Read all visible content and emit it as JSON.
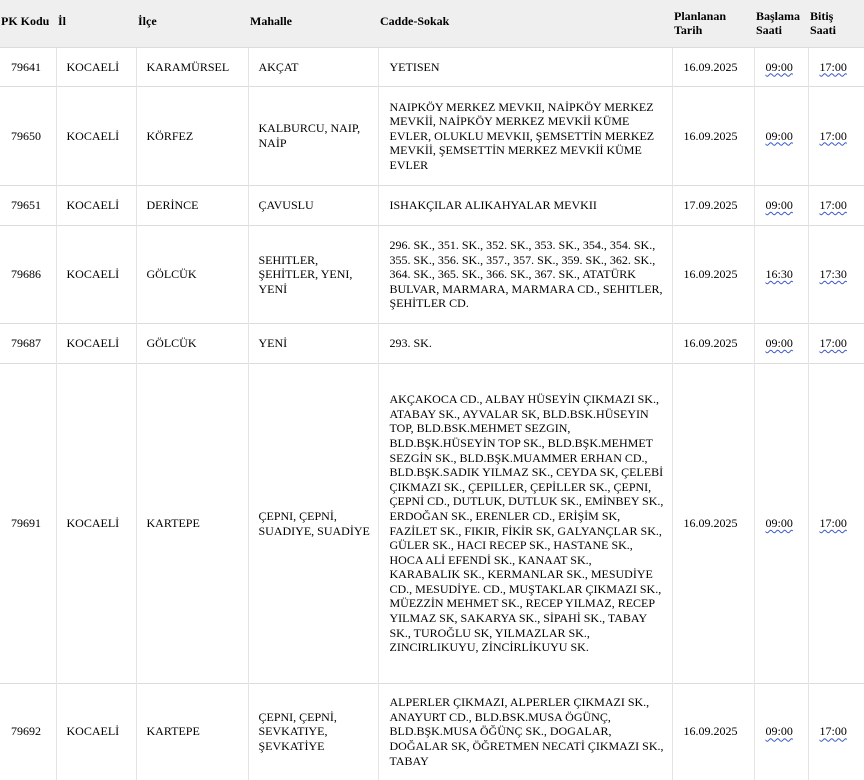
{
  "headers": {
    "pk": "PK Kodu",
    "il": "İl",
    "ilce": "İlçe",
    "mahalle": "Mahalle",
    "cadde": "Cadde-Sokak",
    "tarih_1": "Planlanan",
    "tarih_2": "Tarih",
    "baslama_1": "Başlama",
    "baslama_2": "Saati",
    "bitis_1": "Bitiş",
    "bitis_2": "Saati"
  },
  "rows": [
    {
      "pk": "79641",
      "il": "KOCAELİ",
      "ilce": "KARAMÜRSEL",
      "mahalle": "AKÇAT",
      "cadde": "YETISEN",
      "tarih": "16.09.2025",
      "baslama": "09:00",
      "bitis": "17:00"
    },
    {
      "pk": "79650",
      "il": "KOCAELİ",
      "ilce": "KÖRFEZ",
      "mahalle": "KALBURCU, NAIP, NAİP",
      "cadde": "NAIPKÖY MERKEZ MEVKII, NAİPKÖY MERKEZ MEVKİİ, NAİPKÖY MERKEZ MEVKİİ KÜME EVLER, OLUKLU MEVKII, ŞEMSETTİN MERKEZ MEVKİİ, ŞEMSETTİN MERKEZ MEVKİİ KÜME EVLER",
      "tarih": "16.09.2025",
      "baslama": "09:00",
      "bitis": "17:00"
    },
    {
      "pk": "79651",
      "il": "KOCAELİ",
      "ilce": "DERİNCE",
      "mahalle": "ÇAVUSLU",
      "cadde": "ISHAKÇILAR ALIKAHYALAR MEVKII",
      "tarih": "17.09.2025",
      "baslama": "09:00",
      "bitis": "17:00"
    },
    {
      "pk": "79686",
      "il": "KOCAELİ",
      "ilce": "GÖLCÜK",
      "mahalle": "SEHITLER, ŞEHİTLER, YENI, YENİ",
      "cadde": "296. SK., 351. SK., 352. SK., 353. SK., 354., 354. SK., 355. SK., 356. SK., 357., 357. SK., 359. SK., 362. SK., 364. SK., 365. SK., 366. SK., 367. SK., ATATÜRK BULVAR, MARMARA, MARMARA CD., SEHITLER, ŞEHİTLER CD.",
      "tarih": "16.09.2025",
      "baslama": "16:30",
      "bitis": "17:30"
    },
    {
      "pk": "79687",
      "il": "KOCAELİ",
      "ilce": "GÖLCÜK",
      "mahalle": "YENİ",
      "cadde": "293. SK.",
      "tarih": "16.09.2025",
      "baslama": "09:00",
      "bitis": "17:00"
    },
    {
      "pk": "79691",
      "il": "KOCAELİ",
      "ilce": "KARTEPE",
      "mahalle": "ÇEPNI, ÇEPNİ, SUADIYE, SUADİYE",
      "cadde": "AKÇAKOCA CD., ALBAY HÜSEYİN ÇIKMAZI SK., ATABAY SK., AYVALAR SK, BLD.BSK.HÜSEYIN TOP, BLD.BSK.MEHMET SEZGIN, BLD.BŞK.HÜSEYİN TOP SK., BLD.BŞK.MEHMET SEZGİN SK., BLD.BŞK.MUAMMER ERHAN CD., BLD.BŞK.SADIK YILMAZ SK., CEYDA SK, ÇELEBİ ÇIKMAZI SK., ÇEPILLER, ÇEPİLLER SK., ÇEPNI, ÇEPNİ CD., DUTLUK, DUTLUK SK., EMİNBEY SK., ERDOĞAN SK., ERENLER CD., ERİŞİM SK, FAZİLET SK., FIKIR, FİKİR SK, GALYANÇLAR SK., GÜLER SK., HACI RECEP SK., HASTANE SK., HOCA ALİ EFENDİ SK., KANAAT SK., KARABALIK SK., KERMANLAR SK., MESUDİYE CD., MESUDİYE. CD., MUŞTAKLAR ÇIKMAZI SK., MÜEZZİN MEHMET SK., RECEP YILMAZ, RECEP YILMAZ SK, SAKARYA SK., SİPAHİ SK., TABAY SK., TUROĞLU SK, YILMAZLAR SK., ZINCIRLIKUYU, ZİNCİRLİKUYU SK.",
      "tarih": "16.09.2025",
      "baslama": "09:00",
      "bitis": "17:00"
    },
    {
      "pk": "79692",
      "il": "KOCAELİ",
      "ilce": "KARTEPE",
      "mahalle": "ÇEPNI, ÇEPNİ, SEVKATIYE, ŞEVKATİYE",
      "cadde": "ALPERLER ÇIKMAZI, ALPERLER ÇIKMAZI SK., ANAYURT CD., BLD.BSK.MUSA ÖGÜNÇ, BLD.BŞK.MUSA ÖĞÜNÇ SK., DOGALAR, DOĞALAR SK, ÖĞRETMEN NECATİ ÇIKMAZI SK., TABAY",
      "tarih": "16.09.2025",
      "baslama": "09:00",
      "bitis": "17:00"
    }
  ]
}
